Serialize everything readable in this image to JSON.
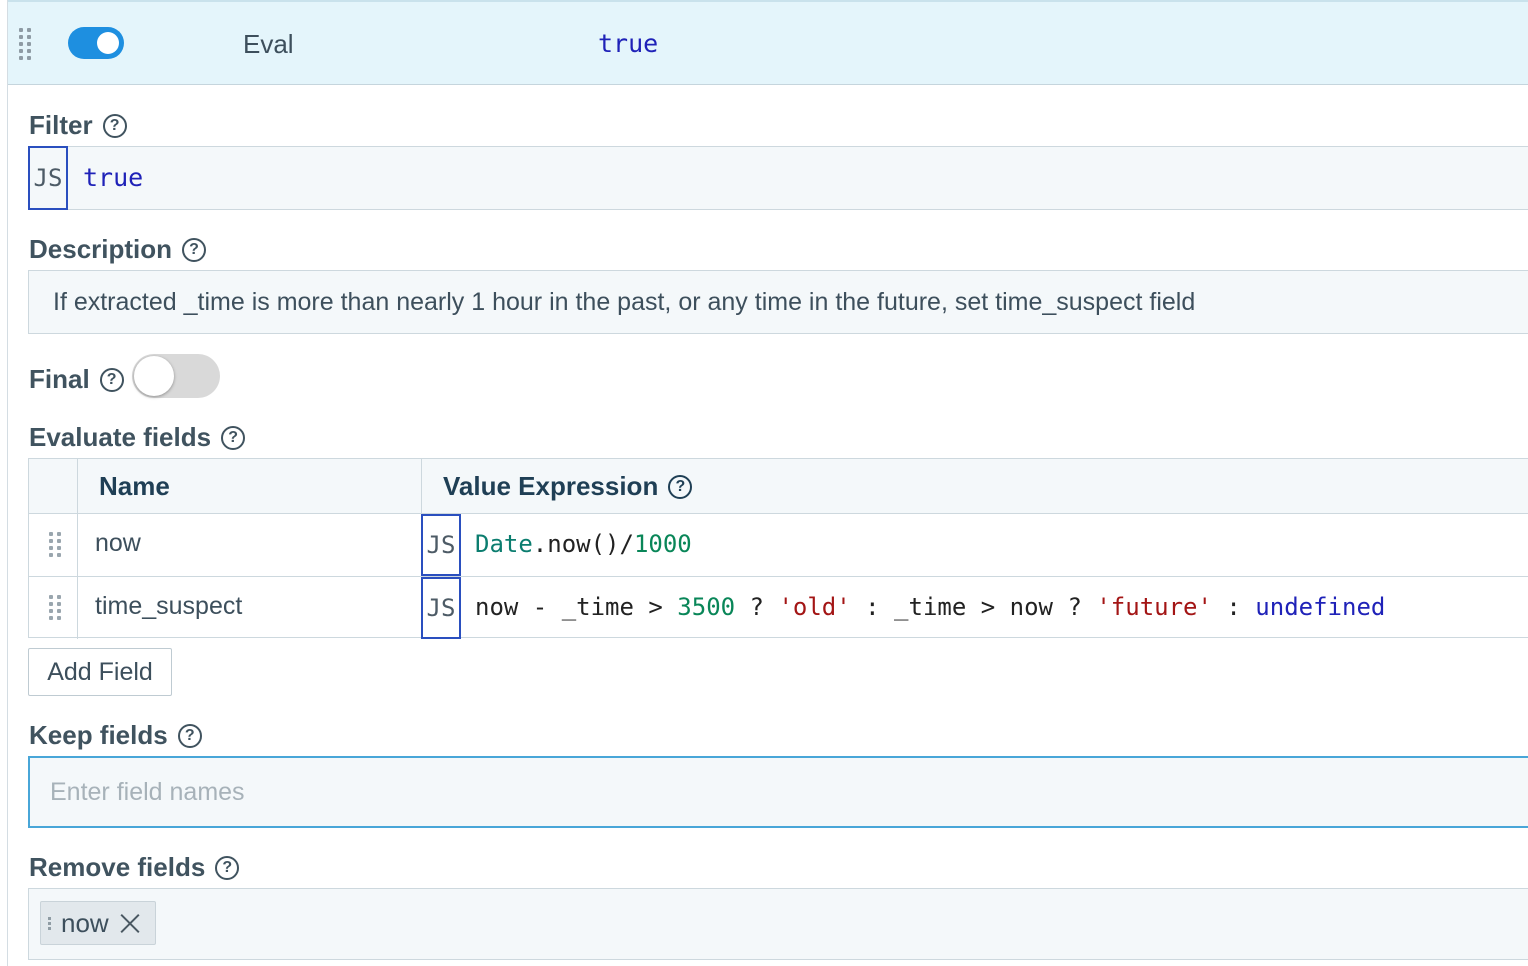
{
  "header": {
    "enabled": true,
    "title": "Eval",
    "filter_preview": "true"
  },
  "filter": {
    "label": "Filter",
    "lang_tag": "JS",
    "value": "true"
  },
  "description": {
    "label": "Description",
    "value": "If extracted _time is more than nearly 1 hour in the past, or any time in the future, set time_suspect field"
  },
  "final": {
    "label": "Final",
    "enabled": false
  },
  "evaluate_fields": {
    "label": "Evaluate fields",
    "columns": {
      "name": "Name",
      "value_expression": "Value Expression"
    },
    "rows": [
      {
        "name": "now",
        "lang_tag": "JS",
        "expression": "Date.now()/1000"
      },
      {
        "name": "time_suspect",
        "lang_tag": "JS",
        "expression": "now - _time > 3500 ? 'old' : _time > now ? 'future' : undefined"
      }
    ],
    "add_button_label": "Add Field"
  },
  "keep_fields": {
    "label": "Keep fields",
    "placeholder": "Enter field names",
    "value": ""
  },
  "remove_fields": {
    "label": "Remove fields",
    "chips": [
      {
        "label": "now"
      }
    ]
  },
  "colors": {
    "accent": "#1e8fe0",
    "header_bg": "#e4f5fb",
    "js_border": "#2a4fbf",
    "keyword": "#1f22b8",
    "number": "#098658",
    "string": "#a31515"
  }
}
